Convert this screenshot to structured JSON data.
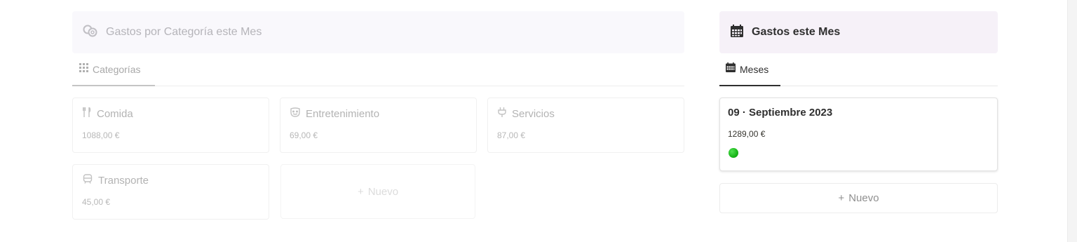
{
  "left": {
    "callout_title": "Gastos por Categoría este Mes",
    "tab_label": "Categorías",
    "cards": [
      {
        "name": "Comida",
        "amount": "1088,00 €",
        "icon": "fork-knife-icon"
      },
      {
        "name": "Entretenimiento",
        "amount": "69,00 €",
        "icon": "theater-mask-icon"
      },
      {
        "name": "Servicios",
        "amount": "87,00 €",
        "icon": "plug-icon"
      },
      {
        "name": "Transporte",
        "amount": "45,00 €",
        "icon": "bus-icon"
      }
    ],
    "new_label": "Nuevo"
  },
  "right": {
    "callout_title": "Gastos este Mes",
    "tab_label": "Meses",
    "card": {
      "name": "09 · Septiembre 2023",
      "amount": "1289,00 €",
      "status_color": "#19b619"
    },
    "new_label": "Nuevo"
  },
  "colors": {
    "accent_callout_right": "#f6f1f8",
    "callout_left": "#f9f8fc"
  }
}
